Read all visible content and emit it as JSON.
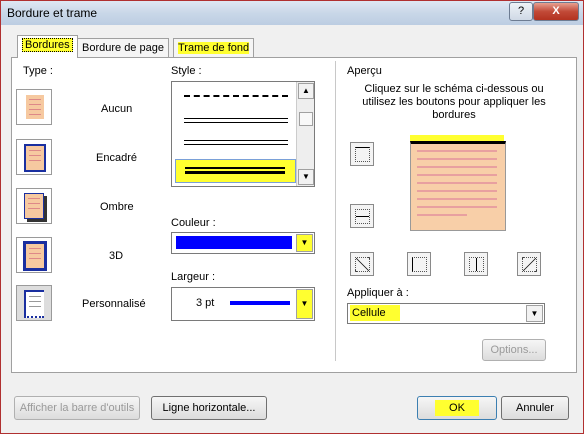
{
  "dialog": {
    "title": "Bordure et trame",
    "help_label": "?",
    "close_label": "X"
  },
  "tabs": [
    {
      "label": "Bordures"
    },
    {
      "label": "Bordure de page"
    },
    {
      "label": "Trame de fond"
    }
  ],
  "type_section": {
    "label": "Type :",
    "items": [
      {
        "label": "Aucun"
      },
      {
        "label": "Encadré"
      },
      {
        "label": "Ombre"
      },
      {
        "label": "3D"
      },
      {
        "label": "Personnalisé"
      }
    ]
  },
  "style_section": {
    "label": "Style :",
    "couleur_label": "Couleur :",
    "couleur_value_color": "#0000ff",
    "largeur_label": "Largeur :",
    "largeur_value": "3 pt"
  },
  "apercu_section": {
    "label": "Aperçu",
    "hint": "Cliquez sur le schéma ci-dessous ou utilisez les boutons pour appliquer les bordures",
    "appliquer_label": "Appliquer à :",
    "appliquer_value": "Cellule",
    "options_button": "Options..."
  },
  "footer": {
    "toolbar_button": "Afficher la barre d'outils",
    "ligne_button": "Ligne horizontale...",
    "ok_button": "OK",
    "cancel_button": "Annuler"
  },
  "colors": {
    "highlight": "#ffff30",
    "border_blue": "#0000ff"
  }
}
